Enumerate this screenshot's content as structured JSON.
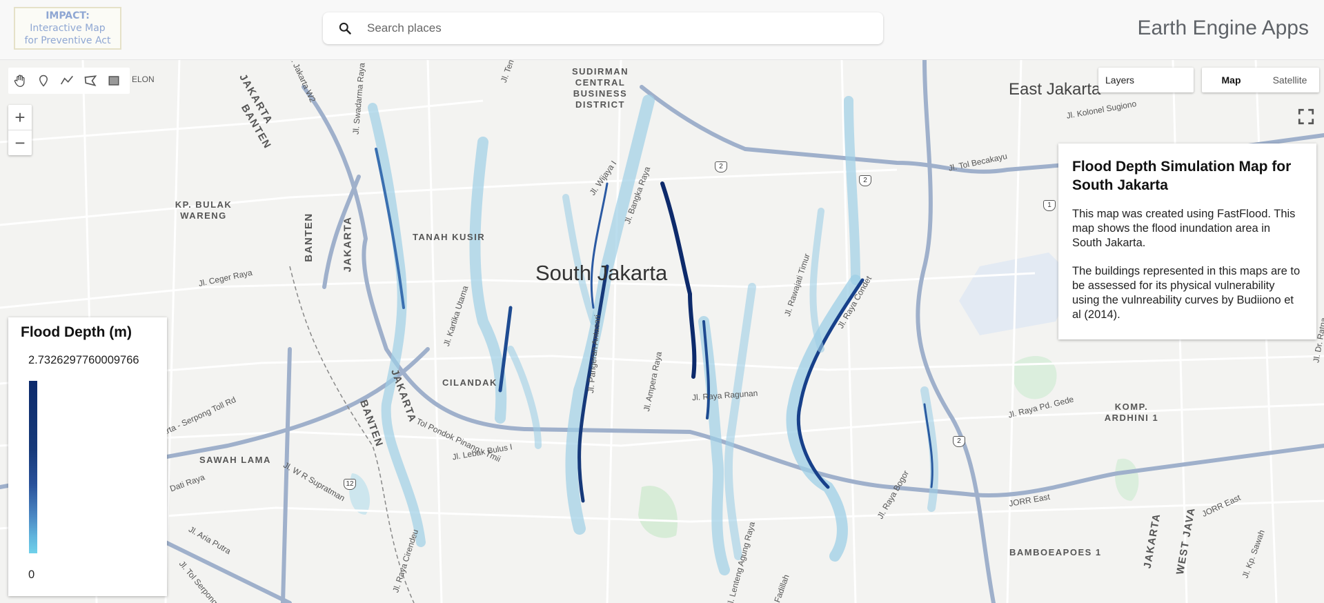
{
  "header": {
    "logo_title": "IMPACT:",
    "logo_line2": "Interactive Map",
    "logo_line3": "for Preventive Act",
    "search_placeholder": "Search places",
    "app_title": "Earth Engine Apps"
  },
  "map_controls": {
    "tools": [
      "hand-icon",
      "marker-icon",
      "line-icon",
      "polygon-icon",
      "rectangle-icon"
    ],
    "zoom_in": "+",
    "zoom_out": "−",
    "layers_label": "Layers",
    "map_type": [
      {
        "label": "Map",
        "active": true
      },
      {
        "label": "Satellite",
        "active": false
      }
    ]
  },
  "info_panel": {
    "title": "Flood Depth Simulation Map for South Jakarta",
    "paragraph1": "This map was created using FastFlood. This map shows the flood inundation area in South Jakarta.",
    "paragraph2": "The buildings represented in this maps are to be assessed for its physical vulnerability using the vulnreability curves by Budiiono et al (2014)."
  },
  "legend": {
    "title": "Flood Depth (m)",
    "max": "2.7326297760009766",
    "min": "0",
    "color_high": "#0c2a6b",
    "color_low": "#6fd1ea"
  },
  "map_labels": {
    "south_jakarta": "South Jakarta",
    "east_jakarta": "East Jakarta",
    "sudirman": "SUDIRMAN CENTRAL BUSINESS DISTRICT",
    "tanah_kusir": "TANAH KUSIR",
    "kp_bulak": "KP. BULAK WARENG",
    "cilandak": "CILANDAK",
    "sawah_lama": "SAWAH LAMA",
    "komp_ardhini": "KOMP. ARDHINI 1",
    "bamboeapoes": "BAMBOEAPOES 1",
    "jakarta": "JAKARTA",
    "banten": "BANTEN",
    "west_java": "WEST JAVA",
    "r_ceger": "Jl. Ceger Raya",
    "r_wijaya": "Jl. Wijaya I",
    "r_bangka": "Jl. Bangka Raya",
    "r_kartika": "Jl. Kartika Utama",
    "r_pangeran": "Jl. Pangeran Antasari",
    "r_ampera": "Jl. Ampera Raya",
    "r_ragunan": "Jl. Raya Ragunan",
    "r_rawajati": "Jl. Rawajati Timur",
    "r_condet": "Jl. Raya Condet",
    "r_lebak": "Jl. Lebak Bulus I",
    "r_tol_pondok": "Tol Pondok Pinang - Tmii",
    "r_serpong": "arta - Serpong Toll Rd",
    "r_tol_becakayu": "Jl. Tol Becakayu",
    "r_kolonel": "Jl. Kolonel Sugiono",
    "r_pd_gede": "Jl. Raya Pd. Gede",
    "r_bogor": "Jl. Raya Bogor",
    "r_jorr": "JORR East",
    "r_jorr2": "JORR East",
    "r_cirendeu": "Jl. Raya Cirendeu",
    "r_lenteng": "Jl. Lenteng Agung Raya",
    "r_fadillah": "Fadillah",
    "r_swadarma": "Jl. Swadarma Raya",
    "r_wr": "Jl. W R Supratman",
    "r_aria": "Jl. Aria Putra",
    "r_pati": "Dati Raya",
    "r_tol_serpong": "Jl. Tol Serpong",
    "r_pdk_pinang": "ELON",
    "r_kp_sawah": "Jl. Kp. Sawah",
    "r_dr_ratna": "Jl. Dr. Ratna",
    "r_jakarta_w2": "Jl. Jakarta W2",
    "r_tendean": "Jl. Ten",
    "shield_2": "2",
    "shield_1": "1",
    "shield_12": "12"
  }
}
